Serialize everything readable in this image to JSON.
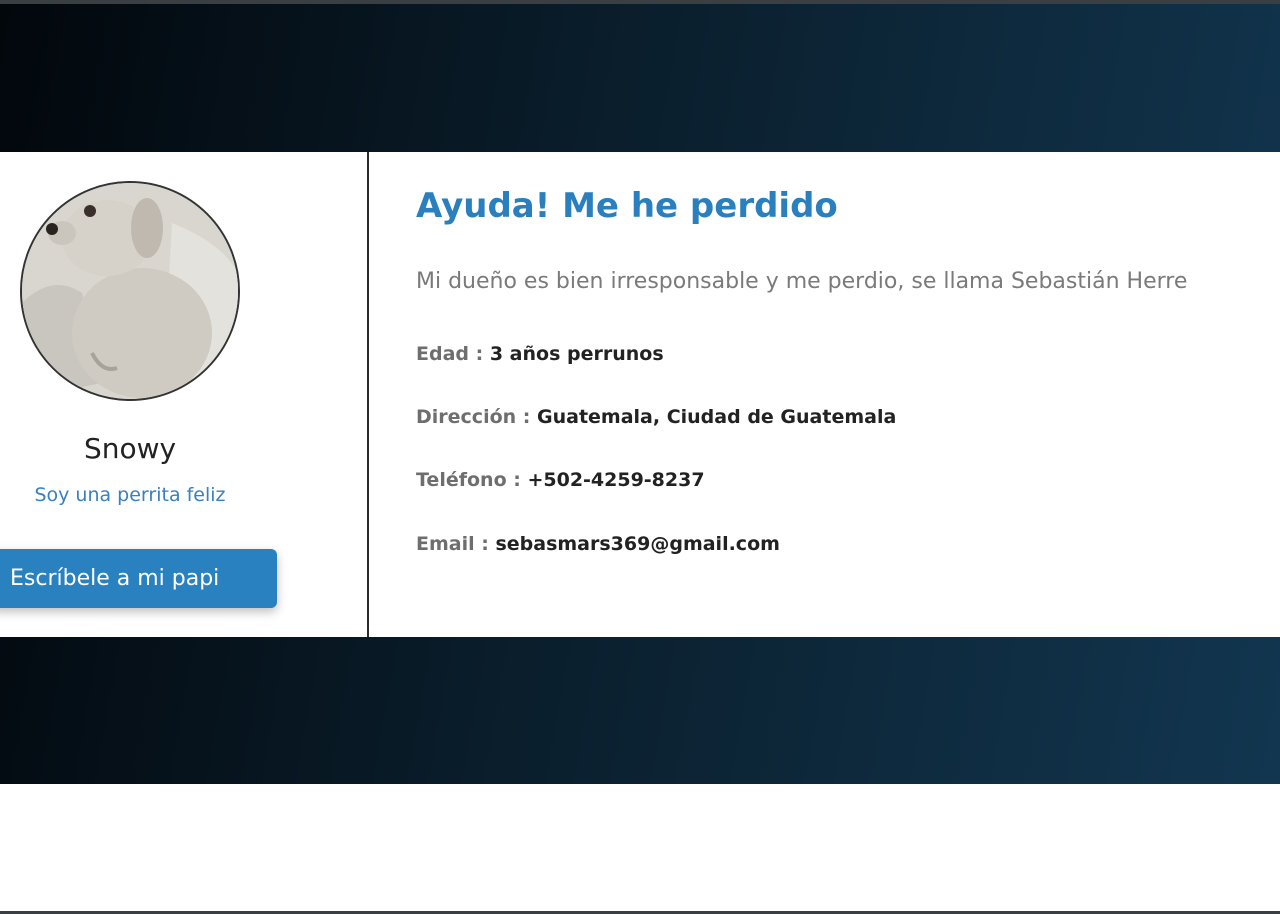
{
  "profile": {
    "name": "Snowy",
    "tagline": "Soy una perrita feliz",
    "button_label": "Escríbele a mi papi",
    "photo_icon": "dog-photo"
  },
  "details": {
    "heading": "Ayuda! Me he perdido",
    "description": "Mi dueño es bien irresponsable y me perdio, se llama Sebastián Herre",
    "fields": [
      {
        "label": "Edad :",
        "value": "3 años perrunos"
      },
      {
        "label": "Dirección :",
        "value": "Guatemala, Ciudad de Guatemala"
      },
      {
        "label": "Teléfono :",
        "value": "+502-4259-8237"
      },
      {
        "label": "Email :",
        "value": "sebasmars369@gmail.com"
      }
    ]
  },
  "colors": {
    "accent": "#2a81bf",
    "hero_dark": "#02070c",
    "hero_light": "#123650"
  }
}
